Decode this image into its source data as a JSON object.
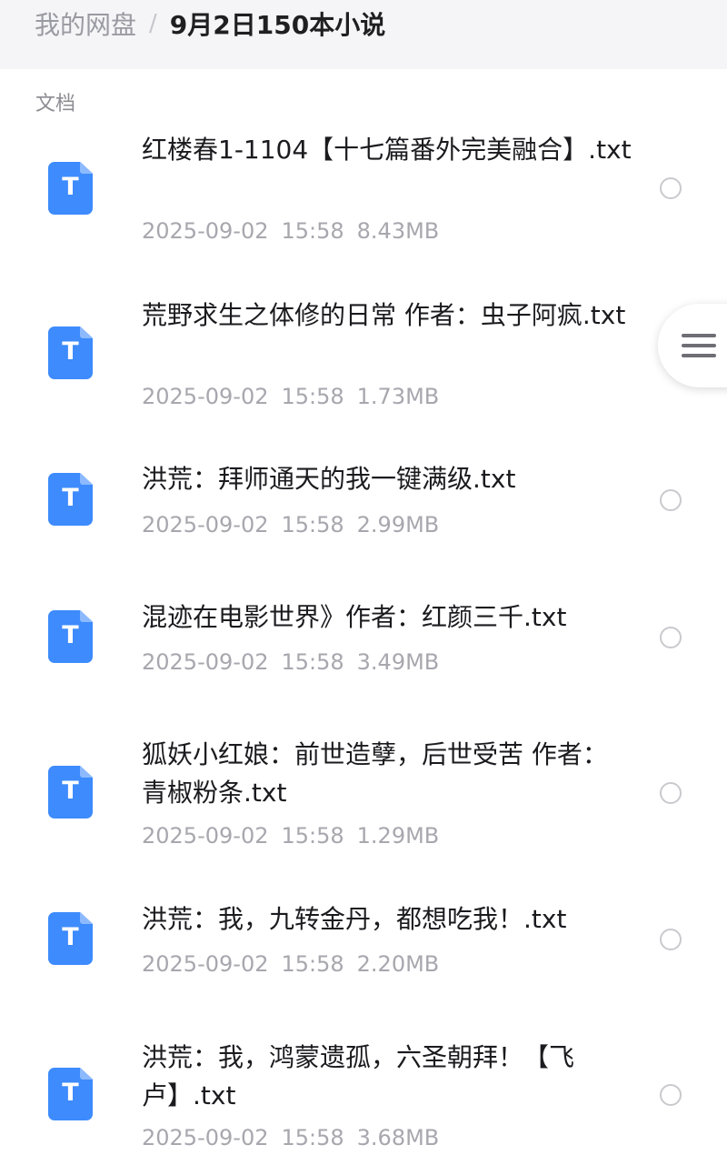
{
  "breadcrumb": {
    "root": "我的网盘",
    "separator": "/",
    "current": "9月2日150本小说"
  },
  "section": {
    "label": "文档"
  },
  "files": [
    {
      "icon_letter": "T",
      "name": "红楼春1-1104【十七篇番外完美融合】.txt",
      "date": "2025-09-02",
      "time": "15:58",
      "size": "8.43MB"
    },
    {
      "icon_letter": "T",
      "name": "荒野求生之体修的日常 作者：虫子阿疯.txt",
      "date": "2025-09-02",
      "time": "15:58",
      "size": "1.73MB"
    },
    {
      "icon_letter": "T",
      "name": "洪荒：拜师通天的我一键满级.txt",
      "date": "2025-09-02",
      "time": "15:58",
      "size": "2.99MB"
    },
    {
      "icon_letter": "T",
      "name": "混迹在电影世界》作者：红颜三千.txt",
      "date": "2025-09-02",
      "time": "15:58",
      "size": "3.49MB"
    },
    {
      "icon_letter": "T",
      "name": "狐妖小红娘：前世造孽，后世受苦 作者：青椒粉条.txt",
      "date": "2025-09-02",
      "time": "15:58",
      "size": "1.29MB"
    },
    {
      "icon_letter": "T",
      "name": "洪荒：我，九转金丹，都想吃我！.txt",
      "date": "2025-09-02",
      "time": "15:58",
      "size": "2.20MB"
    },
    {
      "icon_letter": "T",
      "name": "洪荒：我，鸿蒙遗孤，六圣朝拜！【飞卢】.txt",
      "date": "2025-09-02",
      "time": "15:58",
      "size": "3.68MB"
    }
  ],
  "icons": {
    "file_type": "txt-file-icon",
    "select": "radio-circle-icon",
    "floating_menu": "hamburger-menu-icon"
  },
  "colors": {
    "file_icon": "#3d8bfd",
    "header_bg": "#f5f5f7",
    "meta_text": "#a7a7ae"
  }
}
